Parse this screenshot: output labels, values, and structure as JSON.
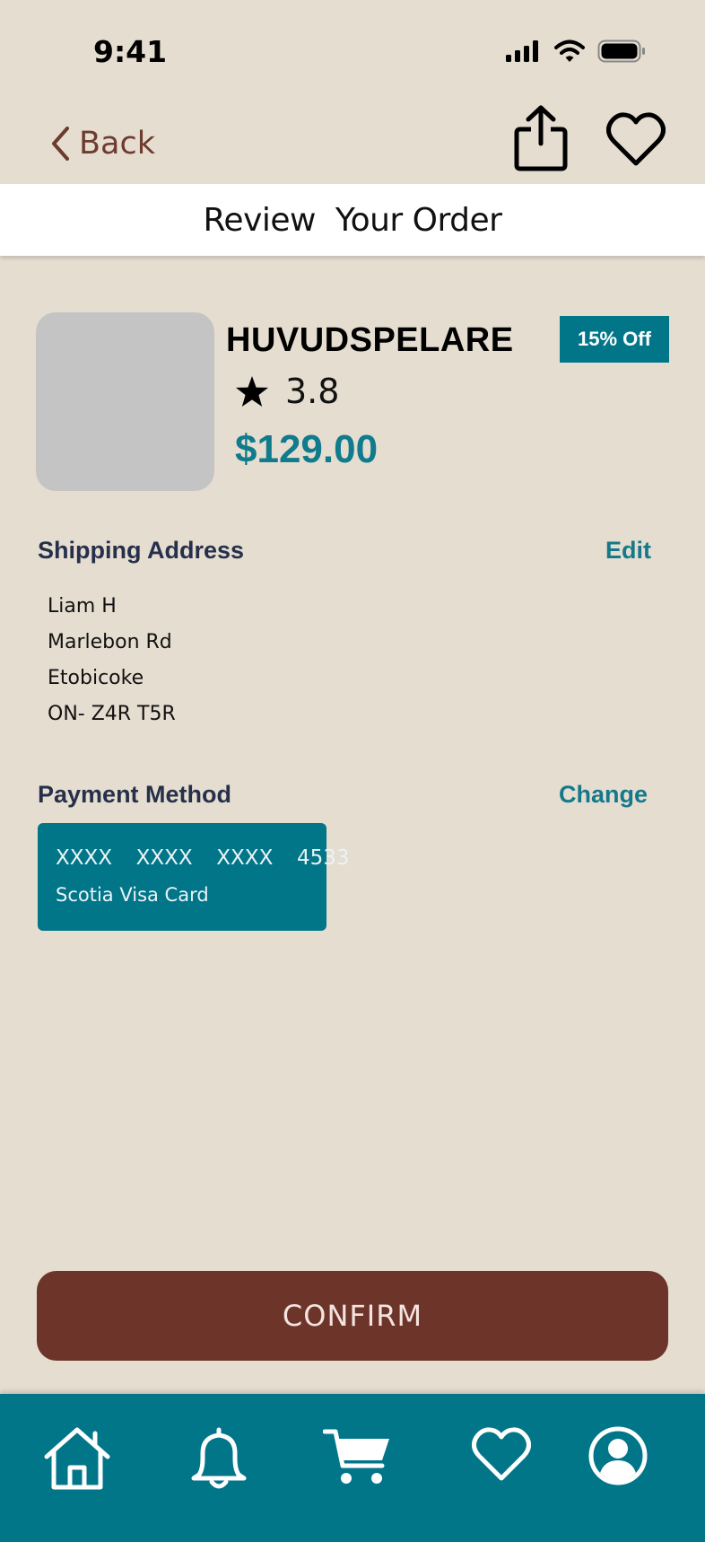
{
  "status_bar": {
    "time": "9:41",
    "icons": [
      "cellular-signal-icon",
      "wifi-icon",
      "battery-icon"
    ]
  },
  "nav": {
    "back_label": "Back",
    "icons": [
      "chevron-left-icon",
      "share-icon",
      "heart-icon"
    ]
  },
  "header": {
    "title": "Review  Your Order"
  },
  "product": {
    "name": "HUVUDSPELARE",
    "discount": "15% Off",
    "rating": "3.8",
    "price": "$129.00"
  },
  "shipping": {
    "title": "Shipping Address",
    "action": "Edit",
    "lines": [
      "Liam H",
      "Marlebon Rd",
      "Etobicoke",
      "ON- Z4R T5R"
    ]
  },
  "payment": {
    "title": "Payment Method",
    "action": "Change",
    "card_number": "XXXX  XXXX  XXXX  4533",
    "card_name": "Scotia Visa Card"
  },
  "confirm_label": "CONFIRM",
  "tab_bar": {
    "items": [
      "home-icon",
      "bell-icon",
      "cart-icon",
      "heart-icon",
      "profile-icon"
    ]
  },
  "colors": {
    "background": "#e6ddd1",
    "accent_teal": "#017689",
    "brown": "#6d342a",
    "navy_text": "#26304a"
  }
}
